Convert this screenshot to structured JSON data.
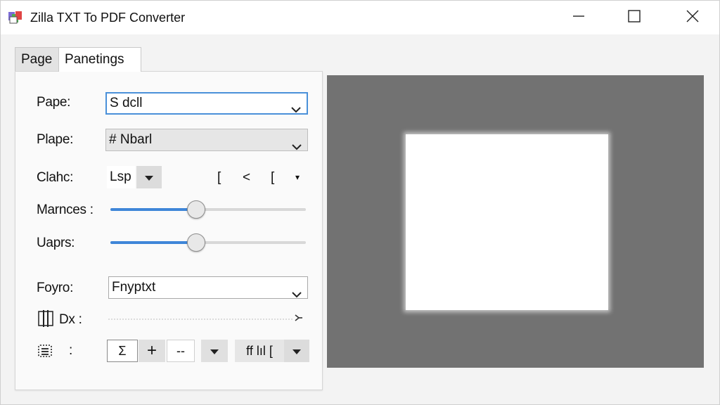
{
  "window": {
    "title": "Zilla TXT To PDF Converter",
    "icon": "pdf-app-icon",
    "controls": [
      "minimize-icon",
      "maximize-icon",
      "close-icon"
    ]
  },
  "tabs": [
    {
      "label": "Page",
      "active": false
    },
    {
      "label": "Panetings",
      "active": true
    }
  ],
  "form": {
    "paper": {
      "label": "Pape:",
      "value": "S dcll"
    },
    "plape": {
      "label": "Plape:",
      "value": "# Nbarl"
    },
    "clahe": {
      "label": "Clahc:",
      "value": "Lsp",
      "symbols": [
        "[",
        "<",
        "[",
        "▾"
      ]
    },
    "marnces": {
      "label": "Marnces :",
      "level_percent": 44
    },
    "uaprs": {
      "label": "Uaprs:",
      "level_percent": 44
    },
    "foyro": {
      "label": "Foyro:",
      "value": "Fnyptxt"
    },
    "dx": {
      "label": "Dx :"
    },
    "bottom_row": {
      "label": ":",
      "field_value": "Σ",
      "plus": "+",
      "minus": "--",
      "font_style": "ff lıl ["
    }
  },
  "colors": {
    "accent": "#3f86d8",
    "preview_bg": "#727272",
    "preview_page": "#ffffff"
  }
}
